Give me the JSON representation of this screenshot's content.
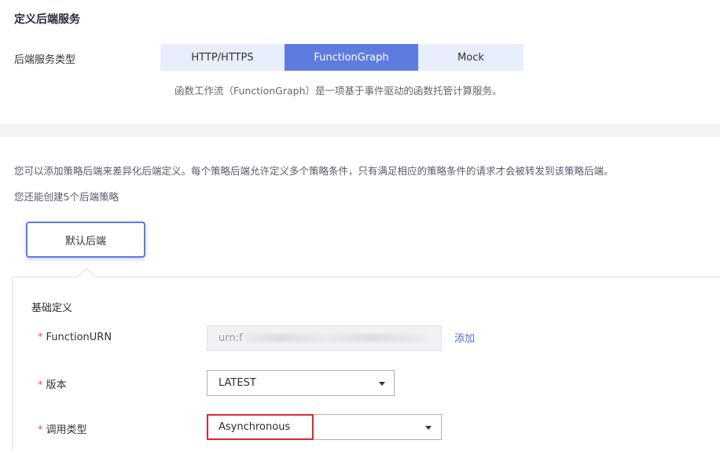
{
  "section": {
    "title": "定义后端服务"
  },
  "backend_type": {
    "label": "后端服务类型",
    "options": [
      {
        "label": "HTTP/HTTPS",
        "active": false
      },
      {
        "label": "FunctionGraph",
        "active": true
      },
      {
        "label": "Mock",
        "active": false
      }
    ],
    "description": "函数工作流（FunctionGraph）是一项基于事件驱动的函数托管计算服务。"
  },
  "policy_info": {
    "line1": "您可以添加策略后端来差异化后端定义。每个策略后端允许定义多个策略条件，只有满足相应的策略条件的请求才会被转发到该策略后端。",
    "line2": "您还能创建5个后端策略"
  },
  "default_backend_tab": "默认后端",
  "form": {
    "section_title": "基础定义",
    "required_mark": "*",
    "function_urn": {
      "label": "FunctionURN",
      "value": "urn:f",
      "add_label": "添加"
    },
    "version": {
      "label": "版本",
      "value": "LATEST"
    },
    "invocation_type": {
      "label": "调用类型",
      "value": "Asynchronous"
    }
  },
  "colors": {
    "accent": "#5e7ce0",
    "segment_bg": "#e8eefb",
    "required": "#e6544e",
    "link": "#526ecc",
    "highlight": "#e0262d"
  }
}
